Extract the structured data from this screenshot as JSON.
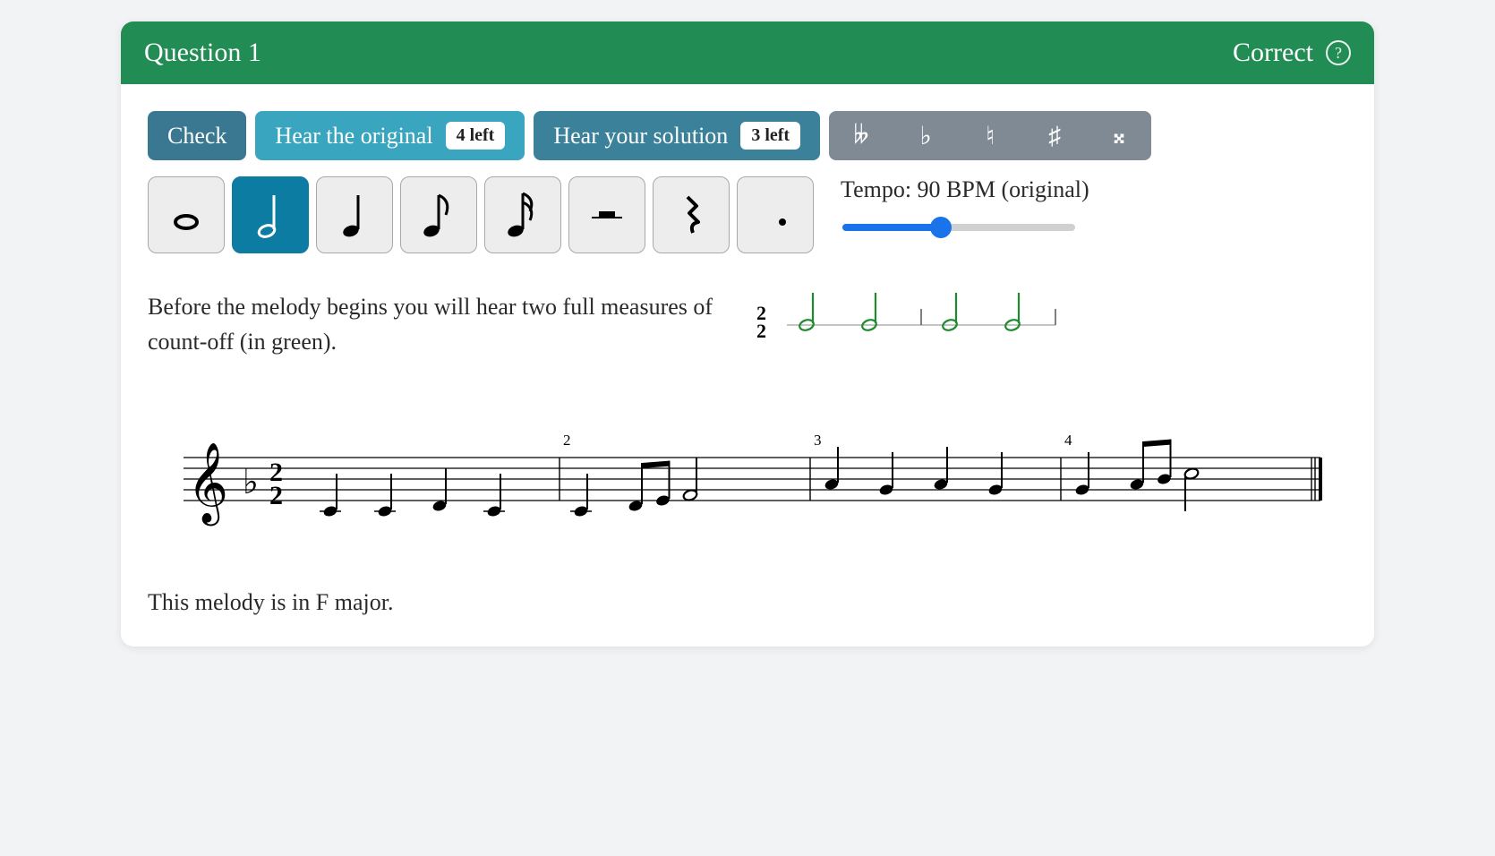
{
  "header": {
    "title": "Question 1",
    "status": "Correct",
    "help_icon": "?"
  },
  "toolbar": {
    "check_label": "Check",
    "hear_original": {
      "label": "Hear the original",
      "badge": "4 left"
    },
    "hear_solution": {
      "label": "Hear your solution",
      "badge": "3 left"
    },
    "accidentals": {
      "double_flat": "𝄫",
      "flat": "♭",
      "natural": "♮",
      "sharp": "♯",
      "double_sharp": "𝄪"
    }
  },
  "note_buttons": {
    "whole": "whole-note",
    "half": "half-note",
    "quarter": "quarter-note",
    "eighth": "eighth-note",
    "sixteenth": "sixteenth-note",
    "rest": "rest",
    "quarter_rest": "quarter-rest",
    "dot": "dot",
    "active": "half"
  },
  "tempo": {
    "label": "Tempo: 90 BPM (original)",
    "value": 90,
    "min": 40,
    "max": 160
  },
  "instruction_text": "Before the melody begins you will hear two full measures of count-off (in green).",
  "countoff": {
    "time_signature": "2/2",
    "beats": 4,
    "color": "#1e8a2e"
  },
  "score": {
    "clef": "treble",
    "key_signature": "1 flat",
    "time_signature": "2/2",
    "measures": [
      {
        "num": 1,
        "notes": [
          "C4 q",
          "C4 q",
          "D4 q",
          "C4 q"
        ]
      },
      {
        "num": 2,
        "notes": [
          "C4 q",
          "D4 e",
          "E4 e",
          "F4 h"
        ]
      },
      {
        "num": 3,
        "notes": [
          "A4 q",
          "G4 q",
          "A4 q",
          "G4 q"
        ]
      },
      {
        "num": 4,
        "notes": [
          "G4 q",
          "A4 e",
          "Bb4 e",
          "C5 h"
        ]
      }
    ]
  },
  "key_label": "This melody is in F major."
}
